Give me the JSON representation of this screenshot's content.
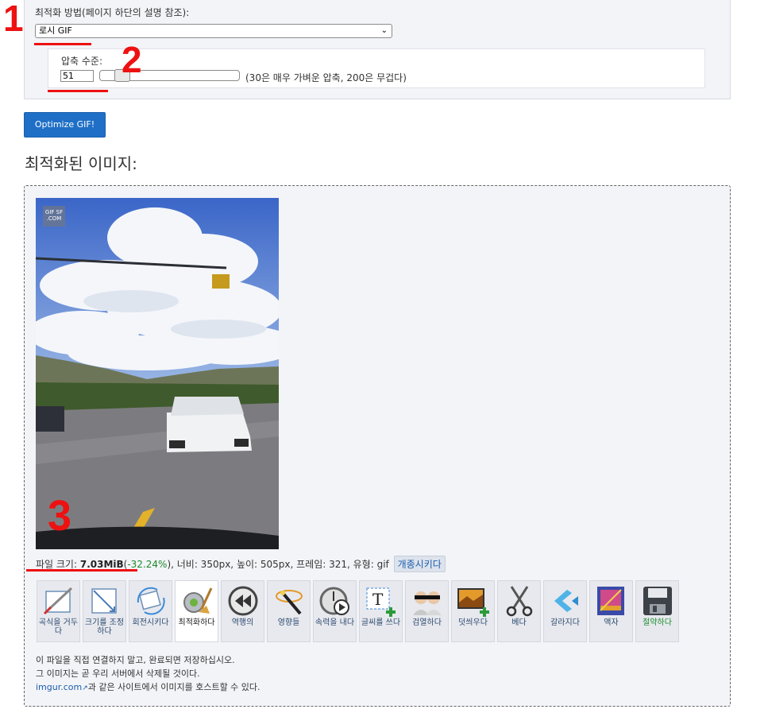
{
  "settings": {
    "method_label": "최적화 방법(페이지 하단의 설명 참조):",
    "method_value": "로시 GIF",
    "level_label": "압축 수준:",
    "level_value": "51",
    "level_fraction": 0.12,
    "level_hint": "(30은 매우 가벼운 압축, 200은 무겁다)"
  },
  "annotations": {
    "mark1": "1",
    "mark2": "2",
    "mark3": "3"
  },
  "optimize_button": "Optimize GIF!",
  "result": {
    "title": "최적화된 이미지:",
    "watermark_line1": "GIF SF",
    "watermark_line2": ".COM",
    "size_label": "파일 크기: ",
    "size_value": "7.03MiB",
    "size_paren_open": "(",
    "size_pct": "-32.24%",
    "size_rest": "), 너비: 350px, 높이: 505px, 프레임: 321, 유형: gif",
    "rename_button": "개종시키다"
  },
  "tools": [
    {
      "label": "곡식을 거두다",
      "icon": "crop-icon"
    },
    {
      "label": "크기를 조정하다",
      "icon": "resize-icon"
    },
    {
      "label": "회전시키다",
      "icon": "rotate-icon"
    },
    {
      "label": "최적화하다",
      "icon": "optimize-icon"
    },
    {
      "label": "역행의",
      "icon": "reverse-icon"
    },
    {
      "label": "영향들",
      "icon": "effects-icon"
    },
    {
      "label": "속력을 내다",
      "icon": "speed-icon"
    },
    {
      "label": "글씨를 쓰다",
      "icon": "text-icon"
    },
    {
      "label": "검열하다",
      "icon": "censor-icon"
    },
    {
      "label": "덧씌우다",
      "icon": "overlay-icon"
    },
    {
      "label": "베다",
      "icon": "cut-icon"
    },
    {
      "label": "갈라지다",
      "icon": "split-icon"
    },
    {
      "label": "액자",
      "icon": "frame-icon"
    },
    {
      "label": "절약하다",
      "icon": "save-icon"
    }
  ],
  "notes": {
    "line1": "이 파일을 직접 연결하지 말고, 완료되면 저장하십시오.",
    "line2": "그 이미지는 곧 우리 서버에서 삭제될 것이다.",
    "link": "imgur.com",
    "line3_rest": "과 같은 사이트에서 이미지를 호스트할 수 있다."
  },
  "colors": {
    "annotation_red": "#ee1111",
    "primary_button": "#1f6fc6",
    "percent_green": "#1c8a2a"
  }
}
